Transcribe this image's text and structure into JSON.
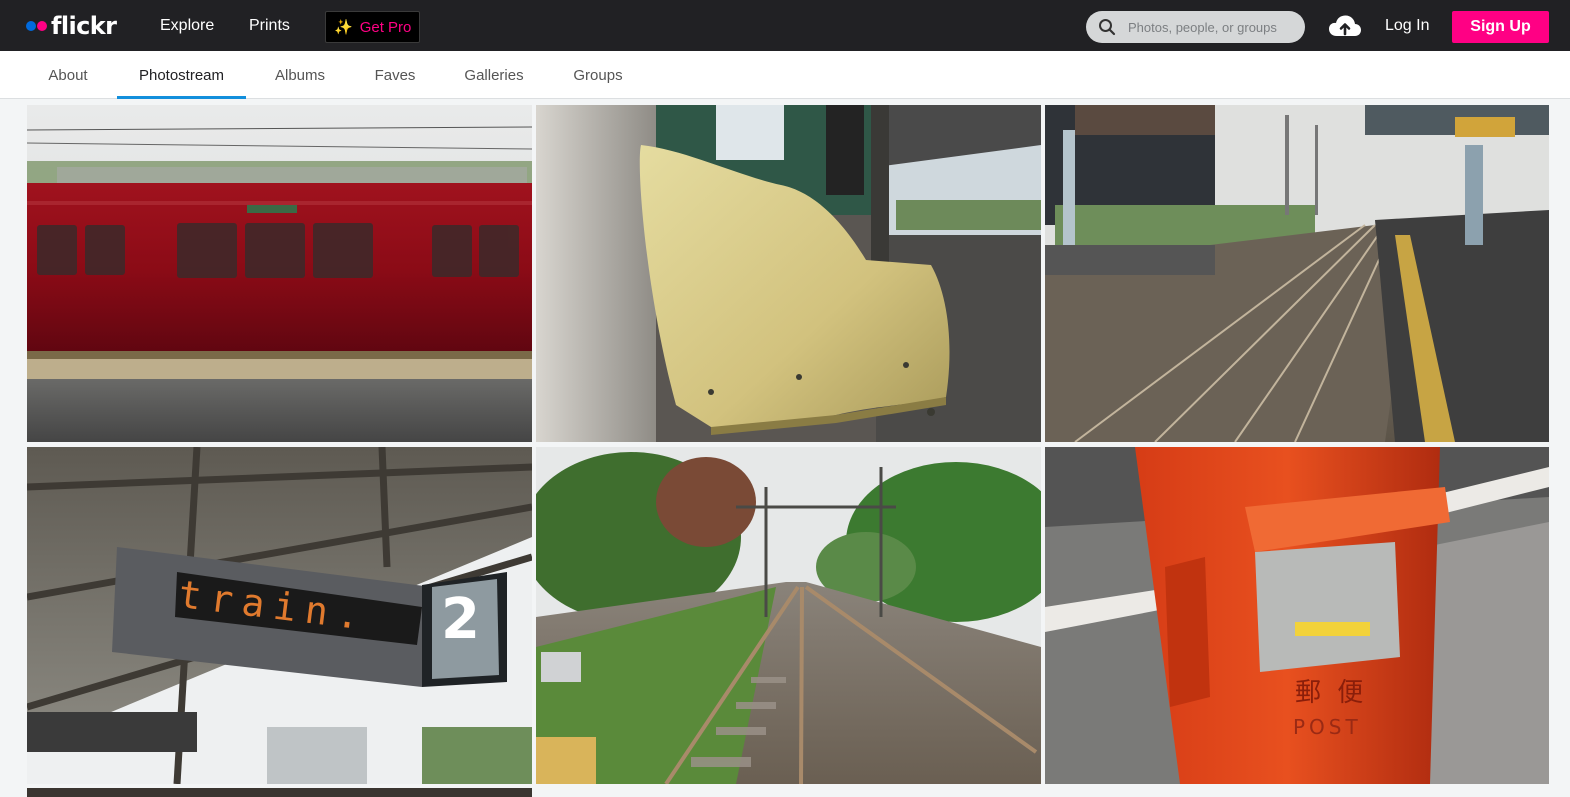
{
  "header": {
    "logo_text": "flickr",
    "nav": [
      "Explore",
      "Prints"
    ],
    "get_pro": "Get Pro",
    "search_placeholder": "Photos, people, or groups",
    "login": "Log In",
    "signup": "Sign Up"
  },
  "subnav": {
    "tabs": [
      "About",
      "Photostream",
      "Albums",
      "Faves",
      "Galleries",
      "Groups"
    ],
    "active": "Photostream"
  },
  "photos": [
    {
      "subject": "red-train-motion-blur"
    },
    {
      "subject": "yellow-platform-bench"
    },
    {
      "subject": "railway-tracks-station"
    },
    {
      "subject": "platform-sign-display",
      "sign_text": "train.",
      "platform_number": "2"
    },
    {
      "subject": "railway-tracks-green-trees"
    },
    {
      "subject": "red-post-box",
      "kanji": "郵 便",
      "post_text": "POST"
    }
  ],
  "colors": {
    "topbar": "#212124",
    "brand_pink": "#ff0084",
    "brand_blue": "#006add",
    "tab_accent": "#128fdc"
  }
}
